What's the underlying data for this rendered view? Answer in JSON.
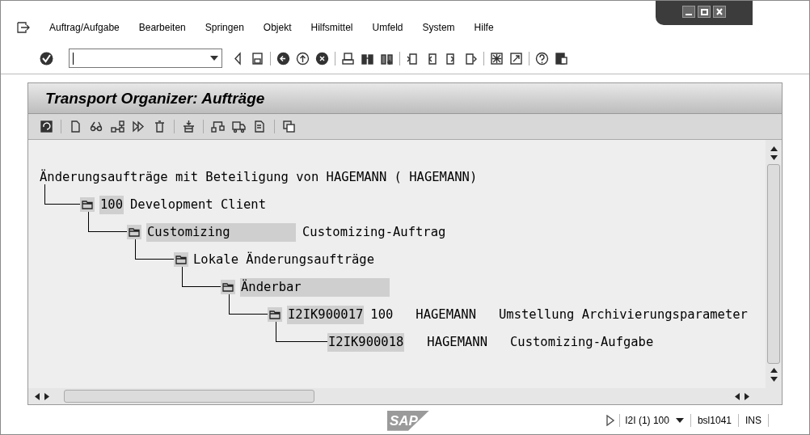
{
  "menu": [
    {
      "label": "Auftrag/Aufgabe"
    },
    {
      "label": "Bearbeiten"
    },
    {
      "label": "Springen"
    },
    {
      "label": "Objekt"
    },
    {
      "label": "Hilfsmittel"
    },
    {
      "label": "Umfeld"
    },
    {
      "label": "System"
    },
    {
      "label": "Hilfe"
    }
  ],
  "title": "Transport Organizer: Aufträge",
  "tree": {
    "root": "Änderungsaufträge mit Beteiligung von HAGEMANN ( HAGEMANN)",
    "children": [
      {
        "folder": true,
        "key": "100",
        "key_wide": false,
        "columns": [
          "Development Client"
        ],
        "children": [
          {
            "folder": true,
            "key": "Customizing",
            "key_wide": true,
            "columns": [
              "Customizing-Auftrag"
            ],
            "children": [
              {
                "folder": true,
                "text": "Lokale Änderungsaufträge",
                "children": [
                  {
                    "folder": true,
                    "key": "Änderbar",
                    "key_wide": true,
                    "children": [
                      {
                        "folder": true,
                        "key": "I2IK900017",
                        "key_wide": false,
                        "columns": [
                          "100",
                          "HAGEMANN",
                          "Umstellung Archivierungsparameter"
                        ],
                        "children": [
                          {
                            "folder": false,
                            "key": "I2IK900018",
                            "key_wide": false,
                            "columns": [
                              "HAGEMANN",
                              "Customizing-Aufgabe"
                            ]
                          }
                        ]
                      }
                    ]
                  }
                ]
              }
            ]
          }
        ]
      }
    ]
  },
  "status_bar": {
    "logo": "SAP",
    "system": "I2I (1) 100",
    "server": "bsl1041",
    "mode": "INS"
  }
}
